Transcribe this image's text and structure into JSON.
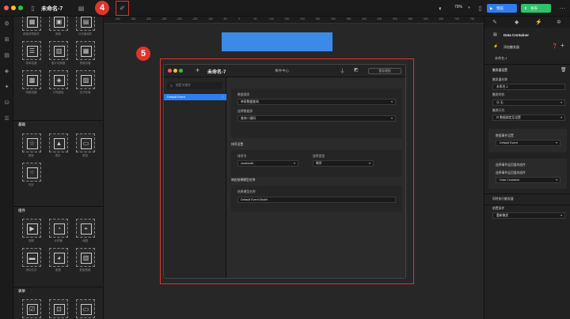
{
  "topbar": {
    "doc_title": "未命名-7",
    "zoom": "79%",
    "preview_label": "预览",
    "publish_label": "发布"
  },
  "ruler_ticks": [
    "-400",
    "-350",
    "-300",
    "-250",
    "-200",
    "-150",
    "-100",
    "-50",
    "0",
    "50",
    "100",
    "150",
    "200",
    "250",
    "300",
    "350",
    "400",
    "450",
    "500",
    "550",
    "600",
    "650",
    "700",
    "750",
    "800"
  ],
  "palette": {
    "items_top": [
      {
        "label": "频道滤镜组件",
        "icon": "▦"
      },
      {
        "label": "面板",
        "icon": "▣"
      },
      {
        "label": "分页面组件",
        "icon": "▤"
      },
      {
        "label": "菜单容器",
        "icon": "☰"
      },
      {
        "label": "图片切换器",
        "icon": "▥"
      },
      {
        "label": "表格容器",
        "icon": "▦"
      },
      {
        "label": "网格容器",
        "icon": "▩"
      },
      {
        "label": "引导面板",
        "icon": "◈"
      },
      {
        "label": "流式布局",
        "icon": "▨"
      }
    ],
    "section_basic": "基础",
    "items_basic": [
      {
        "label": "图标",
        "icon": "☆"
      },
      {
        "label": "图片",
        "icon": "▲"
      },
      {
        "label": "按钮",
        "icon": "▭"
      },
      {
        "label": "热区",
        "icon": "⁘"
      }
    ],
    "section_component": "组件",
    "items_component": [
      {
        "label": "视频",
        "icon": "▶"
      },
      {
        "label": "计时器",
        "icon": "◔"
      },
      {
        "label": "地图",
        "icon": "⌖"
      },
      {
        "label": "滚动文字",
        "icon": "▬"
      },
      {
        "label": "图表",
        "icon": "◕"
      },
      {
        "label": "数据表格",
        "icon": "▥"
      }
    ],
    "section_form": "表单",
    "items_form": [
      {
        "label": "",
        "icon": "☑"
      },
      {
        "label": "",
        "icon": "⊡"
      },
      {
        "label": "",
        "icon": "▭"
      }
    ]
  },
  "annotations": {
    "badge4": "4",
    "badge5": "5"
  },
  "dialog": {
    "title": "未命名-7",
    "center_title": "事件中心",
    "save_label": "保存规则",
    "search_placeholder": "搜索关键字",
    "event_item": "Default Event",
    "datasource_label": "数据源类",
    "datasource_value": "单条数据查询",
    "select_label": "选择数据源",
    "select_value": "查询二维码",
    "sort_section": "排序设置",
    "sort_field_label": "排序字",
    "sort_field_value": "createdAt",
    "sort_type_label": "排序类型",
    "sort_type_value": "降序",
    "model_section": "响应结果模型名称",
    "model_label": "结果模型名称",
    "model_value": "Default Event Model"
  },
  "rightpanel": {
    "container_name": "Data Container",
    "add_trigger": "添加触发器",
    "component_name": "未命名-1",
    "trigger_settings": "触发器设置",
    "trigger_name_label": "触发器名称",
    "trigger_name_value": "未命名-1",
    "trigger_time_label": "触发时机",
    "trigger_time_value": "无",
    "trigger_action_label": "触发行为",
    "trigger_action_value": "数据绑定至设置",
    "data_event_label": "数据事件设置",
    "data_event_value": "Default Event",
    "return_comp_label": "选择事件返回值的组件",
    "return_comp_label2": "选择事件返回值的组件",
    "return_comp_value": "Data Container",
    "exec_trigger_label": "同时执行触发器",
    "page_event_label": "前置条件",
    "page_event_value": "重新触发"
  }
}
